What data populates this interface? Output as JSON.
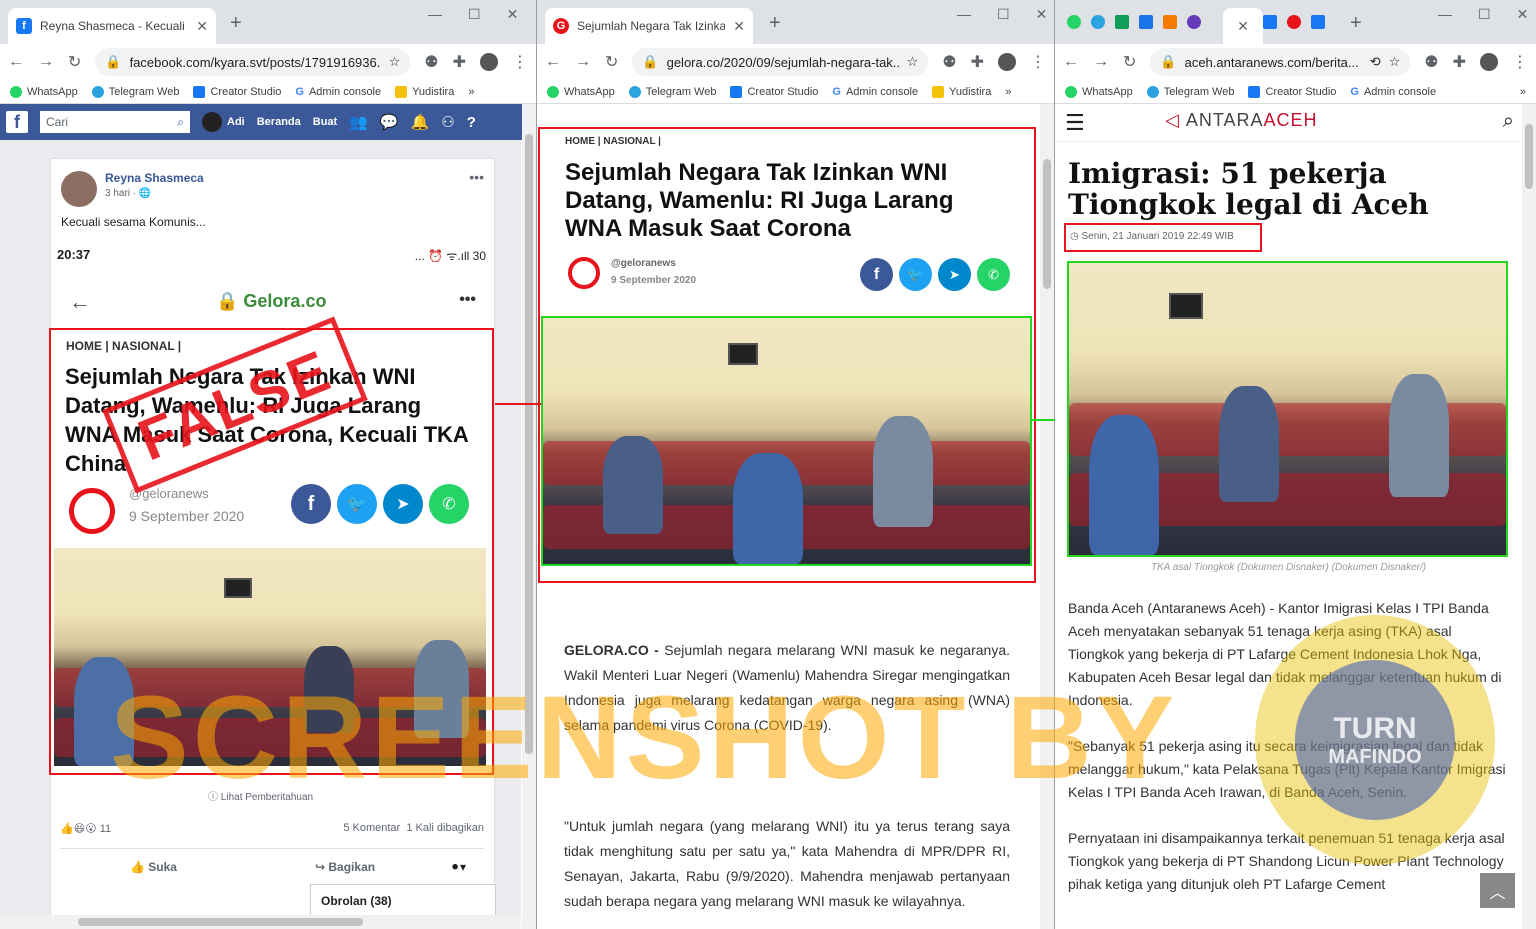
{
  "w1": {
    "tab": "Reyna Shasmeca - Kecuali sesam",
    "url": "facebook.com/kyara.svt/posts/1791916936...",
    "bookmarks": [
      "WhatsApp",
      "Telegram Web",
      "Creator Studio",
      "Admin console",
      "Yudistira"
    ],
    "fb": {
      "search": "Cari",
      "user": "Adi",
      "home": "Beranda",
      "create": "Buat"
    },
    "post": {
      "author": "Reyna Shasmeca",
      "time": "3 hari · ",
      "text": "Kecuali sesama Komunis...",
      "status_time": "20:37",
      "status_icons": "... ⏰ ᯤ.ıll 30",
      "site": "Gelora.co",
      "crumb": "HOME | NASIONAL |",
      "headline": "Sejumlah Negara Tak Izinkan WNI Datang, Wamenlu: RI Juga Larang WNA Masuk Saat Corona, Kecuali TKA China",
      "handle": "@geloranews",
      "date": "9 September 2020",
      "stamp": "FALSE",
      "notice": "Lihat Pemberitahuan",
      "react_count": "11",
      "comments": "5 Komentar",
      "shares": "1 Kali dibagikan",
      "like": "Suka",
      "share": "Bagikan",
      "chat": "Obrolan (38)"
    }
  },
  "w2": {
    "tab": "Sejumlah Negara Tak Izinkan WNI",
    "url": "gelora.co/2020/09/sejumlah-negara-tak...",
    "bookmarks": [
      "WhatsApp",
      "Telegram Web",
      "Creator Studio",
      "Admin console",
      "Yudistira"
    ],
    "crumb": "HOME | NASIONAL |",
    "headline": "Sejumlah Negara Tak Izinkan WNI Datang, Wamenlu: RI Juga Larang WNA Masuk Saat Corona",
    "handle": "@geloranews",
    "date": "9 September 2020",
    "lead_source": "GELORA.CO - ",
    "lead": "Sejumlah negara melarang WNI masuk ke negaranya. Wakil Menteri Luar Negeri (Wamenlu) Mahendra Siregar mengingatkan Indonesia juga melarang kedatangan warga negara asing (WNA) selama pandemi virus Corona (COVID-19).",
    "quote": "\"Untuk jumlah negara (yang melarang WNI) itu ya terus terang saya tidak menghitung satu per satu ya,\" kata Mahendra di MPR/DPR RI, Senayan, Jakarta, Rabu (9/9/2020). Mahendra menjawab pertanyaan sudah berapa negara yang melarang WNI masuk ke wilayahnya."
  },
  "w3": {
    "url": "aceh.antaranews.com/berita...",
    "bookmarks": [
      "WhatsApp",
      "Telegram Web",
      "Creator Studio",
      "Admin console"
    ],
    "brand": "ANTARA",
    "brand2": "ACEH",
    "headline": "Imigrasi: 51 pekerja Tiongkok legal di Aceh",
    "date": "Senin, 21 Januari 2019 22:49 WIB",
    "caption": "TKA asal Tiongkok (Dokumen Disnaker) (Dokumen Disnaker/)",
    "p1": "Banda Aceh (Antaranews Aceh) - Kantor Imigrasi Kelas I TPI Banda Aceh menyatakan sebanyak 51 tenaga kerja asing (TKA) asal Tiongkok yang bekerja di PT Lafarge Cement Indonesia Lhok Nga, Kabupaten Aceh Besar legal dan tidak melanggar ketentuan hukum di Indonesia.",
    "p2": "\"Sebanyak 51 pekerja asing itu secara keimigrasian legal dan tidak melanggar hukum,\" kata Pelaksana Tugas (Plt) Kepala Kantor Imigrasi Kelas I TPI Banda Aceh Irawan, di Banda Aceh, Senin.",
    "p3": "Pernyataan ini disampaikannya terkait penemuan 51 tenaga kerja asal Tiongkok yang bekerja di PT Shandong Licun Power Plant Technology pihak ketiga yang ditunjuk oleh PT Lafarge Cement"
  },
  "watermark": "SCREENSHOT BY",
  "badge_top": "TURN",
  "badge_bottom": "MAFINDO"
}
